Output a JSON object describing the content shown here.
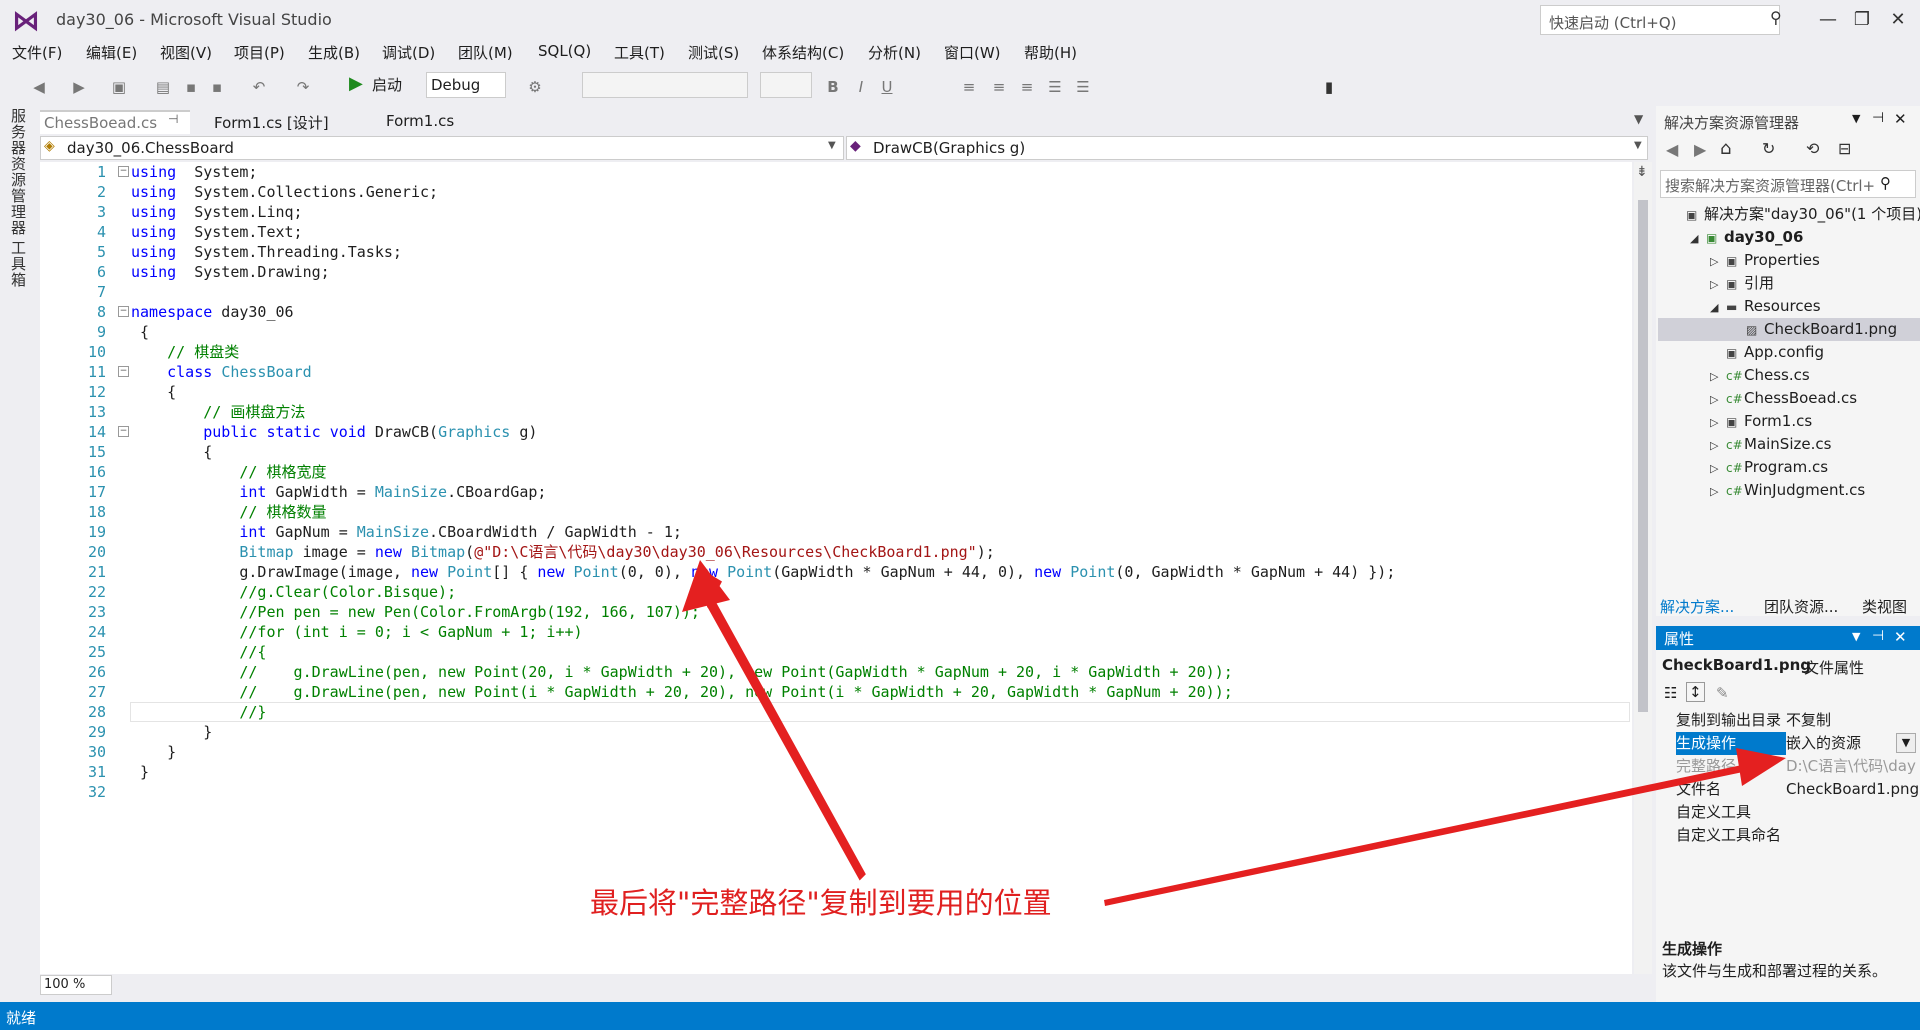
{
  "window": {
    "title": "day30_06 - Microsoft Visual Studio",
    "quick_launch": "快速启动 (Ctrl+Q)",
    "min": "—",
    "restore": "❐",
    "close": "✕"
  },
  "menu": [
    "文件(F)",
    "编辑(E)",
    "视图(V)",
    "项目(P)",
    "生成(B)",
    "调试(D)",
    "团队(M)",
    "SQL(Q)",
    "工具(T)",
    "测试(S)",
    "体系结构(C)",
    "分析(N)",
    "窗口(W)",
    "帮助(H)"
  ],
  "toolbar": {
    "start": "启动",
    "config": "Debug"
  },
  "left_tabs": [
    "服务器资源管理器",
    "工具箱"
  ],
  "tabs": [
    "ChessBoead.cs",
    "Form1.cs [设计]",
    "Form1.cs"
  ],
  "nav": {
    "class_dropdown": "day30_06.ChessBoard",
    "method_dropdown": "DrawCB(Graphics g)"
  },
  "code_lines": [
    [
      [
        "kw",
        "using"
      ],
      [
        "",
        "  System;"
      ]
    ],
    [
      [
        "kw",
        "using"
      ],
      [
        "",
        "  System.Collections.Generic;"
      ]
    ],
    [
      [
        "kw",
        "using"
      ],
      [
        "",
        "  System.Linq;"
      ]
    ],
    [
      [
        "kw",
        "using"
      ],
      [
        "",
        "  System.Text;"
      ]
    ],
    [
      [
        "kw",
        "using"
      ],
      [
        "",
        "  System.Threading.Tasks;"
      ]
    ],
    [
      [
        "kw",
        "using"
      ],
      [
        "",
        "  System.Drawing;"
      ]
    ],
    [],
    [
      [
        "kw",
        "namespace"
      ],
      [
        "",
        " day30_06"
      ]
    ],
    [
      [
        "",
        " {"
      ]
    ],
    [
      [
        "cm",
        "    // 棋盘类"
      ]
    ],
    [
      [
        "",
        "    "
      ],
      [
        "kw",
        "class"
      ],
      [
        "",
        " "
      ],
      [
        "ty",
        "ChessBoard"
      ]
    ],
    [
      [
        "",
        "    {"
      ]
    ],
    [
      [
        "cm",
        "        // 画棋盘方法"
      ]
    ],
    [
      [
        "",
        "        "
      ],
      [
        "kw",
        "public"
      ],
      [
        "",
        " "
      ],
      [
        "kw",
        "static"
      ],
      [
        "",
        " "
      ],
      [
        "kw",
        "void"
      ],
      [
        "",
        " DrawCB("
      ],
      [
        "ty",
        "Graphics"
      ],
      [
        "",
        " g)"
      ]
    ],
    [
      [
        "",
        "        {"
      ]
    ],
    [
      [
        "cm",
        "            // 棋格宽度"
      ]
    ],
    [
      [
        "",
        "            "
      ],
      [
        "kw",
        "int"
      ],
      [
        "",
        " GapWidth = "
      ],
      [
        "ty",
        "MainSize"
      ],
      [
        "",
        ".CBoardGap;"
      ]
    ],
    [
      [
        "cm",
        "            // 棋格数量"
      ]
    ],
    [
      [
        "",
        "            "
      ],
      [
        "kw",
        "int"
      ],
      [
        "",
        " GapNum = "
      ],
      [
        "ty",
        "MainSize"
      ],
      [
        "",
        ".CBoardWidth / GapWidth - 1;"
      ]
    ],
    [
      [
        "",
        "            "
      ],
      [
        "ty",
        "Bitmap"
      ],
      [
        "",
        " image = "
      ],
      [
        "kw",
        "new"
      ],
      [
        "",
        " "
      ],
      [
        "ty",
        "Bitmap"
      ],
      [
        "",
        "("
      ],
      [
        "st",
        "@\"D:\\C语言\\代码\\day30\\day30_06\\Resources\\CheckBoard1.png\""
      ],
      [
        "",
        ");"
      ]
    ],
    [
      [
        "",
        "            g.DrawImage(image, "
      ],
      [
        "kw",
        "new"
      ],
      [
        "",
        " "
      ],
      [
        "ty",
        "Point"
      ],
      [
        "",
        "[] { "
      ],
      [
        "kw",
        "new"
      ],
      [
        "",
        " "
      ],
      [
        "ty",
        "Point"
      ],
      [
        "",
        "(0, 0), "
      ],
      [
        "kw",
        "new"
      ],
      [
        "",
        " "
      ],
      [
        "ty",
        "Point"
      ],
      [
        "",
        "(GapWidth * GapNum + 44, 0), "
      ],
      [
        "kw",
        "new"
      ],
      [
        "",
        " "
      ],
      [
        "ty",
        "Point"
      ],
      [
        "",
        "(0, GapWidth * GapNum + 44) });"
      ]
    ],
    [
      [
        "cm",
        "            //g.Clear(Color.Bisque);"
      ]
    ],
    [
      [
        "cm",
        "            //Pen pen = new Pen(Color.FromArgb(192, 166, 107));"
      ]
    ],
    [
      [
        "cm",
        "            //for (int i = 0; i < GapNum + 1; i++)"
      ]
    ],
    [
      [
        "cm",
        "            //{"
      ]
    ],
    [
      [
        "cm",
        "            //    g.DrawLine(pen, new Point(20, i * GapWidth + 20), new Point(GapWidth * GapNum + 20, i * GapWidth + 20));"
      ]
    ],
    [
      [
        "cm",
        "            //    g.DrawLine(pen, new Point(i * GapWidth + 20, 20), new Point(i * GapWidth + 20, GapWidth * GapNum + 20));"
      ]
    ],
    [
      [
        "cm",
        "            //}"
      ]
    ],
    [
      [
        "",
        "        }"
      ]
    ],
    [
      [
        "",
        "    }"
      ]
    ],
    [
      [
        "",
        " }"
      ]
    ],
    []
  ],
  "zoom": "100 %",
  "status": "就绪",
  "solution": {
    "title": "解决方案资源管理器",
    "search": "搜索解决方案资源管理器(Ctrl+",
    "items": [
      {
        "label": "解决方案\"day30_06\"(1 个项目)",
        "icon": "solution-icon",
        "indent": 0,
        "arrow": ""
      },
      {
        "label": "day30_06",
        "icon": "project-icon",
        "indent": 1,
        "arrow": "◢",
        "bold": true
      },
      {
        "label": "Properties",
        "icon": "wrench-icon",
        "indent": 2,
        "arrow": "▷"
      },
      {
        "label": "引用",
        "icon": "references-icon",
        "indent": 2,
        "arrow": "▷"
      },
      {
        "label": "Resources",
        "icon": "folder-icon",
        "indent": 2,
        "arrow": "◢"
      },
      {
        "label": "CheckBoard1.png",
        "icon": "image-file-icon",
        "indent": 3,
        "arrow": ""
      },
      {
        "label": "App.config",
        "icon": "config-icon",
        "indent": 2,
        "arrow": ""
      },
      {
        "label": "Chess.cs",
        "icon": "csharp-icon",
        "indent": 2,
        "arrow": "▷"
      },
      {
        "label": "ChessBoead.cs",
        "icon": "csharp-icon",
        "indent": 2,
        "arrow": "▷"
      },
      {
        "label": "Form1.cs",
        "icon": "form-icon",
        "indent": 2,
        "arrow": "▷"
      },
      {
        "label": "MainSize.cs",
        "icon": "csharp-icon",
        "indent": 2,
        "arrow": "▷"
      },
      {
        "label": "Program.cs",
        "icon": "csharp-icon",
        "indent": 2,
        "arrow": "▷"
      },
      {
        "label": "WinJudgment.cs",
        "icon": "csharp-icon",
        "indent": 2,
        "arrow": "▷"
      }
    ],
    "bottom_tabs": [
      "解决方案...",
      "团队资源...",
      "类视图"
    ]
  },
  "properties": {
    "title": "属性",
    "object": "CheckBoard1.png",
    "object_type": "文件属性",
    "rows": [
      {
        "name": "复制到输出目录",
        "value": "不复制"
      },
      {
        "name": "生成操作",
        "value": "嵌入的资源"
      },
      {
        "name": "完整路径",
        "value": "D:\\C语言\\代码\\day"
      },
      {
        "name": "文件名",
        "value": "CheckBoard1.png"
      },
      {
        "name": "自定义工具",
        "value": ""
      },
      {
        "name": "自定义工具命名",
        "value": ""
      }
    ],
    "desc_title": "生成操作",
    "desc_text": "该文件与生成和部署过程的关系。"
  },
  "annotation": "最后将\"完整路径\"复制到要用的位置",
  "colors": {
    "accent": "#007acc",
    "annotation": "#e02020"
  }
}
